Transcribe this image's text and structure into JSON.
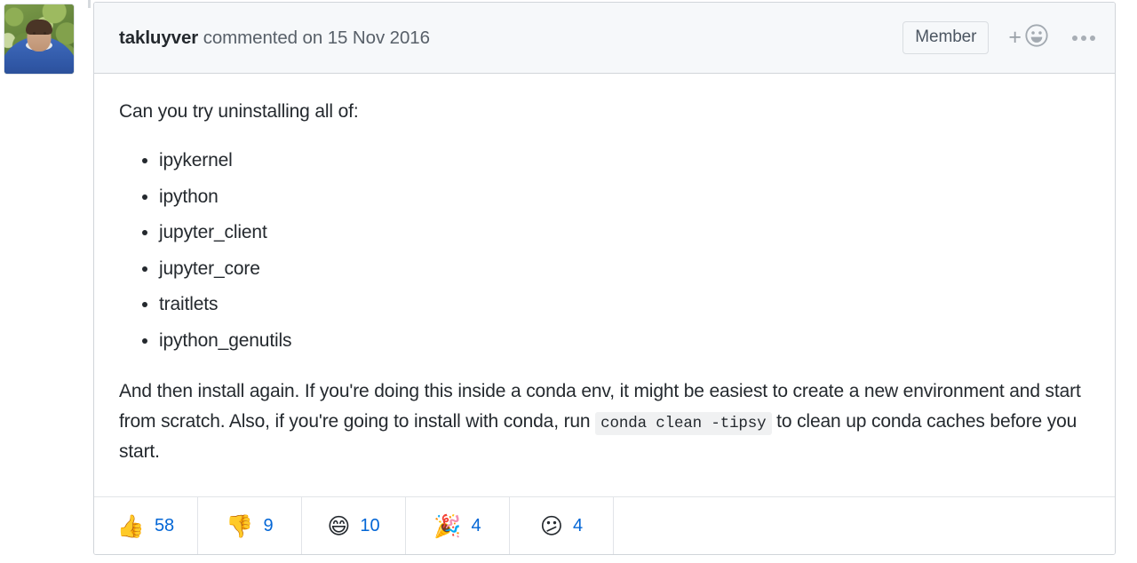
{
  "avatar": {
    "alt": "takluyver avatar"
  },
  "comment": {
    "header": {
      "author": "takluyver",
      "meta": " commented on 15 Nov 2016",
      "badge": "Member",
      "add_reaction_icon": "smiley-plus-icon",
      "menu_icon": "kebab-menu-icon"
    },
    "body": {
      "lead": "Can you try uninstalling all of:",
      "list": [
        "ipykernel",
        "ipython",
        "jupyter_client",
        "jupyter_core",
        "traitlets",
        "ipython_genutils"
      ],
      "paragraph_part1": "And then install again. If you're doing this inside a conda env, it might be easiest to create a new environment and start from scratch. Also, if you're going to install with conda, run ",
      "code": "conda clean -tipsy",
      "paragraph_part2": " to clean up conda caches before you start."
    },
    "reactions": [
      {
        "name": "thumbs-up",
        "emoji": "👍",
        "count": "58"
      },
      {
        "name": "thumbs-down",
        "emoji": "👎",
        "count": "9"
      },
      {
        "name": "laugh",
        "emoji": "😄",
        "count": "10"
      },
      {
        "name": "hooray",
        "emoji": "🎉",
        "count": "4"
      },
      {
        "name": "confused",
        "emoji": "😕",
        "count": "4"
      }
    ]
  },
  "colors": {
    "accent_link": "#0366d6",
    "header_bg": "#f6f8fa",
    "border": "#d1d5da",
    "text": "#24292e",
    "muted_text": "#586069"
  }
}
